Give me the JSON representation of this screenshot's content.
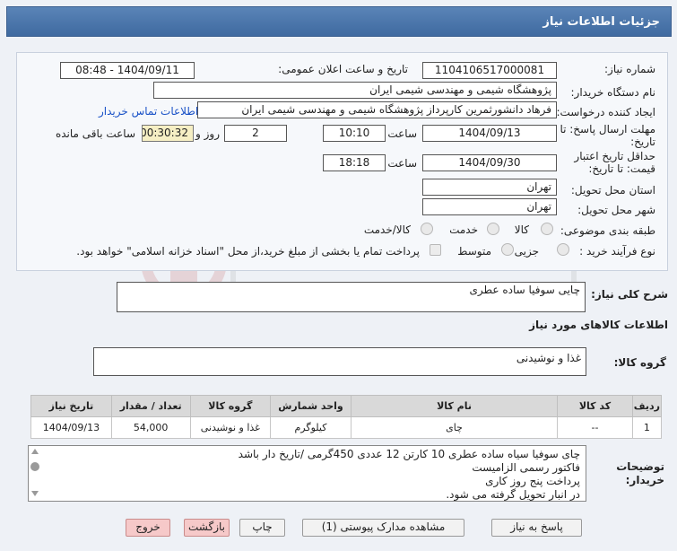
{
  "header": {
    "title": "جزئیات اطلاعات نیاز"
  },
  "form": {
    "need_number_label": "شماره نیاز:",
    "need_number": "1104106517000081",
    "announce_label": "تاریخ و ساعت اعلان عمومی:",
    "announce_value": "1404/09/11 - 08:48",
    "buyer_label": "نام دستگاه خریدار:",
    "buyer_value": "پژوهشگاه شیمی و مهندسی شیمی ایران",
    "creator_label": "ایجاد کننده درخواست:",
    "creator_value": "فرهاد دانشورثمرین کارپرداز پژوهشگاه شیمی و مهندسی شیمی ایران",
    "contact_link": "اطلاعات تماس خریدار",
    "reply_label_1": "مهلت ارسال پاسخ: تا",
    "reply_label_2": "تاریخ:",
    "reply_date": "1404/09/13",
    "time_label": "ساعت",
    "reply_time": "10:10",
    "days_value": "2",
    "days_label": "روز و",
    "remaining_time": "00:30:32",
    "remaining_label": "ساعت باقی مانده",
    "validity_label_1": "حداقل تاریخ اعتبار",
    "validity_label_2": "قیمت: تا تاریخ:",
    "validity_date": "1404/09/30",
    "validity_time_label": "ساعت",
    "validity_time": "18:18",
    "province_label": "استان محل تحویل:",
    "province_value": "تهران",
    "city_label": "شهر محل تحویل:",
    "city_value": "تهران",
    "category_label": "طبقه بندی موضوعی:",
    "category_options": [
      "کالا",
      "خدمت",
      "کالا/خدمت"
    ],
    "process_label": "نوع فرآیند خرید :",
    "process_options": [
      "جزیی",
      "متوسط"
    ],
    "payment_note": "پرداخت تمام یا بخشی از مبلغ خرید،از محل \"اسناد خزانه اسلامی\" خواهد بود."
  },
  "summary": {
    "label": "شرح کلی نیاز:",
    "value": "چایی سوفیا ساده عطری",
    "goods_info_title": "اطلاعات کالاهای مورد نیاز",
    "group_label": "گروه کالا:",
    "group_value": "غذا و نوشیدنی"
  },
  "table": {
    "headers": [
      "ردیف",
      "کد کالا",
      "نام کالا",
      "واحد شمارش",
      "گروه کالا",
      "تعداد / مقدار",
      "تاریخ نیاز"
    ],
    "rows": [
      [
        "1",
        "--",
        "چای",
        "کیلوگرم",
        "غذا و نوشیدنی",
        "54,000",
        "1404/09/13"
      ]
    ]
  },
  "notes": {
    "label_1": "توضیحات",
    "label_2": "خریدار:",
    "lines": [
      "چای سوفیا سیاه ساده عطری 10 کارتن 12 عددی 450گرمی /تاریخ دار باشد",
      "فاکتور رسمی الزامیست",
      "پرداخت پنج روز کاری",
      "در انبار تحویل گرفته می شود."
    ]
  },
  "buttons": {
    "reply": "پاسخ به نیاز",
    "docs": "مشاهده مدارک پیوستی (1)",
    "print": "چاپ",
    "back": "بازگشت",
    "exit": "خروج"
  },
  "colors": {
    "header_bg": "#4a76ab",
    "link": "#1a52c7",
    "highlight": "#f6efc4",
    "danger_button": "#f6c9c9"
  }
}
